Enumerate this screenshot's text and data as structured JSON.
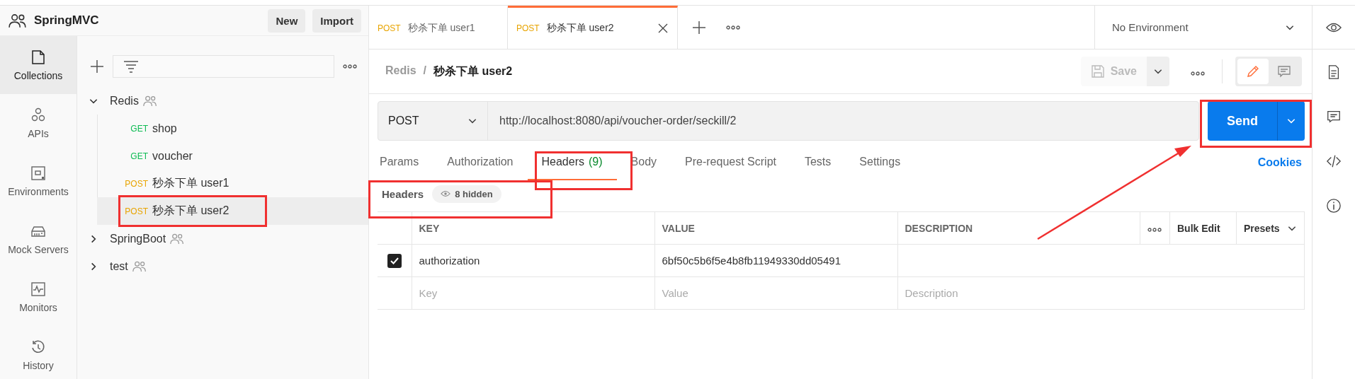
{
  "workspace": {
    "name": "SpringMVC",
    "buttons": [
      "New",
      "Import"
    ]
  },
  "nav": [
    {
      "label": "Collections",
      "selected": true
    },
    {
      "label": "APIs",
      "selected": false
    },
    {
      "label": "Environments",
      "selected": false
    },
    {
      "label": "Mock Servers",
      "selected": false
    },
    {
      "label": "Monitors",
      "selected": false
    },
    {
      "label": "History",
      "selected": false
    }
  ],
  "tree": [
    {
      "name": "Redis",
      "shared": true,
      "expanded": true,
      "children": [
        {
          "method": "GET",
          "name": "shop",
          "selected": false
        },
        {
          "method": "GET",
          "name": "voucher",
          "selected": false
        },
        {
          "method": "POST",
          "name": "秒杀下单 user1",
          "selected": false
        },
        {
          "method": "POST",
          "name": "秒杀下单 user2",
          "selected": true
        }
      ]
    },
    {
      "name": "SpringBoot",
      "shared": true,
      "expanded": false
    },
    {
      "name": "test",
      "shared": true,
      "expanded": false
    }
  ],
  "tabs": [
    {
      "method": "POST",
      "name": "秒杀下单 user1",
      "selected": false
    },
    {
      "method": "POST",
      "name": "秒杀下单 user2",
      "selected": true
    }
  ],
  "environment": "No Environment",
  "breadcrumb": {
    "parent": "Redis",
    "separator": "/",
    "current": "秒杀下单 user2"
  },
  "save_button": {
    "label": "Save",
    "disabled": true
  },
  "request": {
    "method": "POST",
    "url": "http://localhost:8080/api/voucher-order/seckill/2",
    "send": "Send"
  },
  "request_tabs": [
    {
      "label": "Params",
      "selected": false
    },
    {
      "label": "Authorization",
      "selected": false
    },
    {
      "label": "Headers",
      "count": "(9)",
      "selected": true
    },
    {
      "label": "Body",
      "selected": false
    },
    {
      "label": "Pre-request Script",
      "selected": false
    },
    {
      "label": "Tests",
      "selected": false
    },
    {
      "label": "Settings",
      "selected": false
    }
  ],
  "cookies": "Cookies",
  "headers": {
    "title": "Headers",
    "hidden": "8 hidden",
    "columns": [
      "KEY",
      "VALUE",
      "DESCRIPTION"
    ],
    "bulk_edit": "Bulk Edit",
    "presets": "Presets",
    "rows": [
      {
        "key": "authorization",
        "value": "6bf50c5b6f5e4b8fb11949330dd05491",
        "checked": true
      }
    ],
    "placeholders": {
      "key": "Key",
      "value": "Value",
      "description": "Description"
    }
  }
}
